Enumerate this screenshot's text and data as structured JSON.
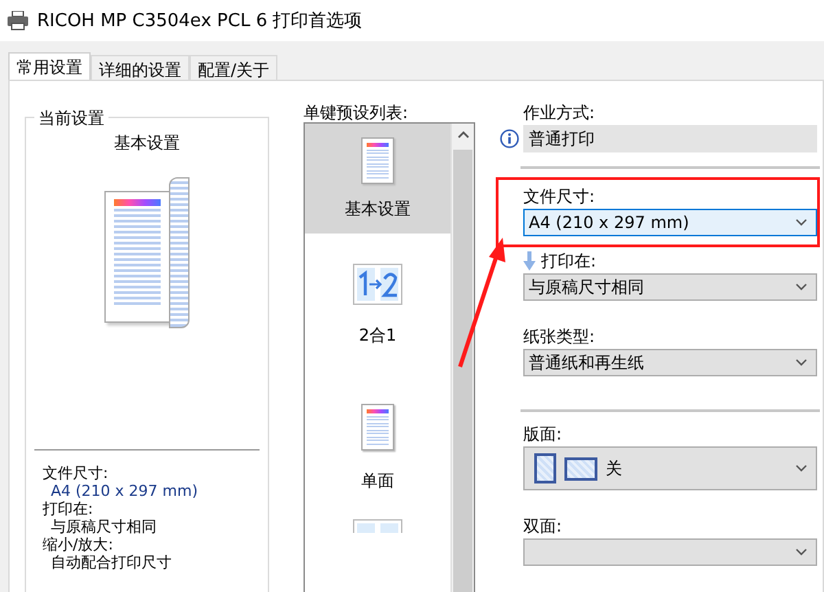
{
  "window": {
    "title": "RICOH MP C3504ex PCL 6 打印首选项"
  },
  "tabs": [
    {
      "label": "常用设置",
      "selected": true
    },
    {
      "label": "详细的设置",
      "selected": false
    },
    {
      "label": "配置/关于",
      "selected": false
    }
  ],
  "current_settings": {
    "group_title": "当前设置",
    "preset_name": "基本设置",
    "summary": [
      {
        "label": "文件尺寸:",
        "value": "A4 (210 x 297 mm)"
      },
      {
        "label": "打印在:",
        "value": "与原稿尺寸相同"
      },
      {
        "label": "缩小/放大:",
        "value": "自动配合打印尺寸"
      }
    ]
  },
  "presets": {
    "label": "单键预设列表:",
    "items": [
      {
        "kind": "document",
        "name": "基本设置",
        "selected": true
      },
      {
        "kind": "two-in-one",
        "name": "2合1",
        "selected": false
      },
      {
        "kind": "single",
        "name": "单面",
        "selected": false
      },
      {
        "kind": "duplex",
        "selected": false
      }
    ]
  },
  "fields": [
    {
      "kind": "static",
      "label": "作业方式:",
      "value": "普通打印",
      "highlighted": false,
      "divider_after": true
    },
    {
      "kind": "dropdown",
      "label": "文件尺寸:",
      "value": "A4 (210 x 297 mm)",
      "highlighted": true,
      "divider_after": false
    },
    {
      "kind": "dropdown",
      "label": "打印在:",
      "value": "与原稿尺寸相同",
      "highlighted": false,
      "divider_after": false
    },
    {
      "kind": "dropdown",
      "label": "纸张类型:",
      "value": "普通纸和再生纸",
      "highlighted": false,
      "divider_after": true
    },
    {
      "kind": "layout",
      "label": "版面:",
      "value": "关",
      "highlighted": false,
      "divider_after": false
    },
    {
      "kind": "dropdown",
      "label": "双面:",
      "highlighted": false,
      "divider_after": false
    }
  ],
  "annotation_arrow": true
}
